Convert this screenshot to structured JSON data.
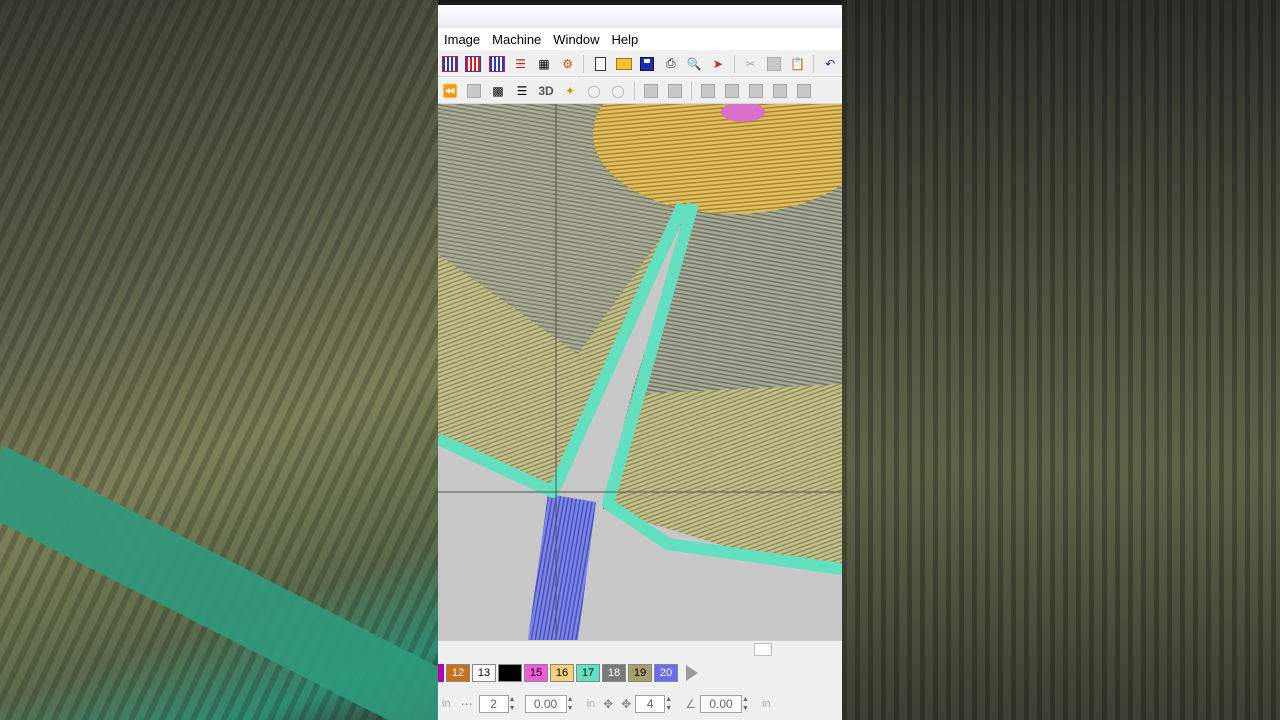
{
  "menu": {
    "items": [
      {
        "label": "Image"
      },
      {
        "label": "Machine"
      },
      {
        "label": "Window"
      },
      {
        "label": "Help"
      }
    ]
  },
  "toolbar2": {
    "label_3d": "3D"
  },
  "palette": {
    "swatches": [
      {
        "label": "12",
        "color": "#c7711f"
      },
      {
        "label": "13",
        "color": "#ffffff"
      },
      {
        "label": "",
        "color": "#000000"
      },
      {
        "label": "15",
        "color": "#f05ad6"
      },
      {
        "label": "16",
        "color": "#f5d27a"
      },
      {
        "label": "17",
        "color": "#62e0bf"
      },
      {
        "label": "18",
        "color": "#7a7a7a"
      },
      {
        "label": "19",
        "color": "#a5a16a"
      },
      {
        "label": "20",
        "color": "#6b6cf0"
      }
    ]
  },
  "controls": {
    "count_value": "2",
    "offset_value": "0.00",
    "step_value": "4",
    "angle_value": "0.00",
    "unit_in": "in"
  },
  "colors": {
    "outline_green": "#62e0bf",
    "stem_blue": "#6f78e0",
    "center_gold": "#d8b44a",
    "petal_khaki": "#c9c58a"
  }
}
